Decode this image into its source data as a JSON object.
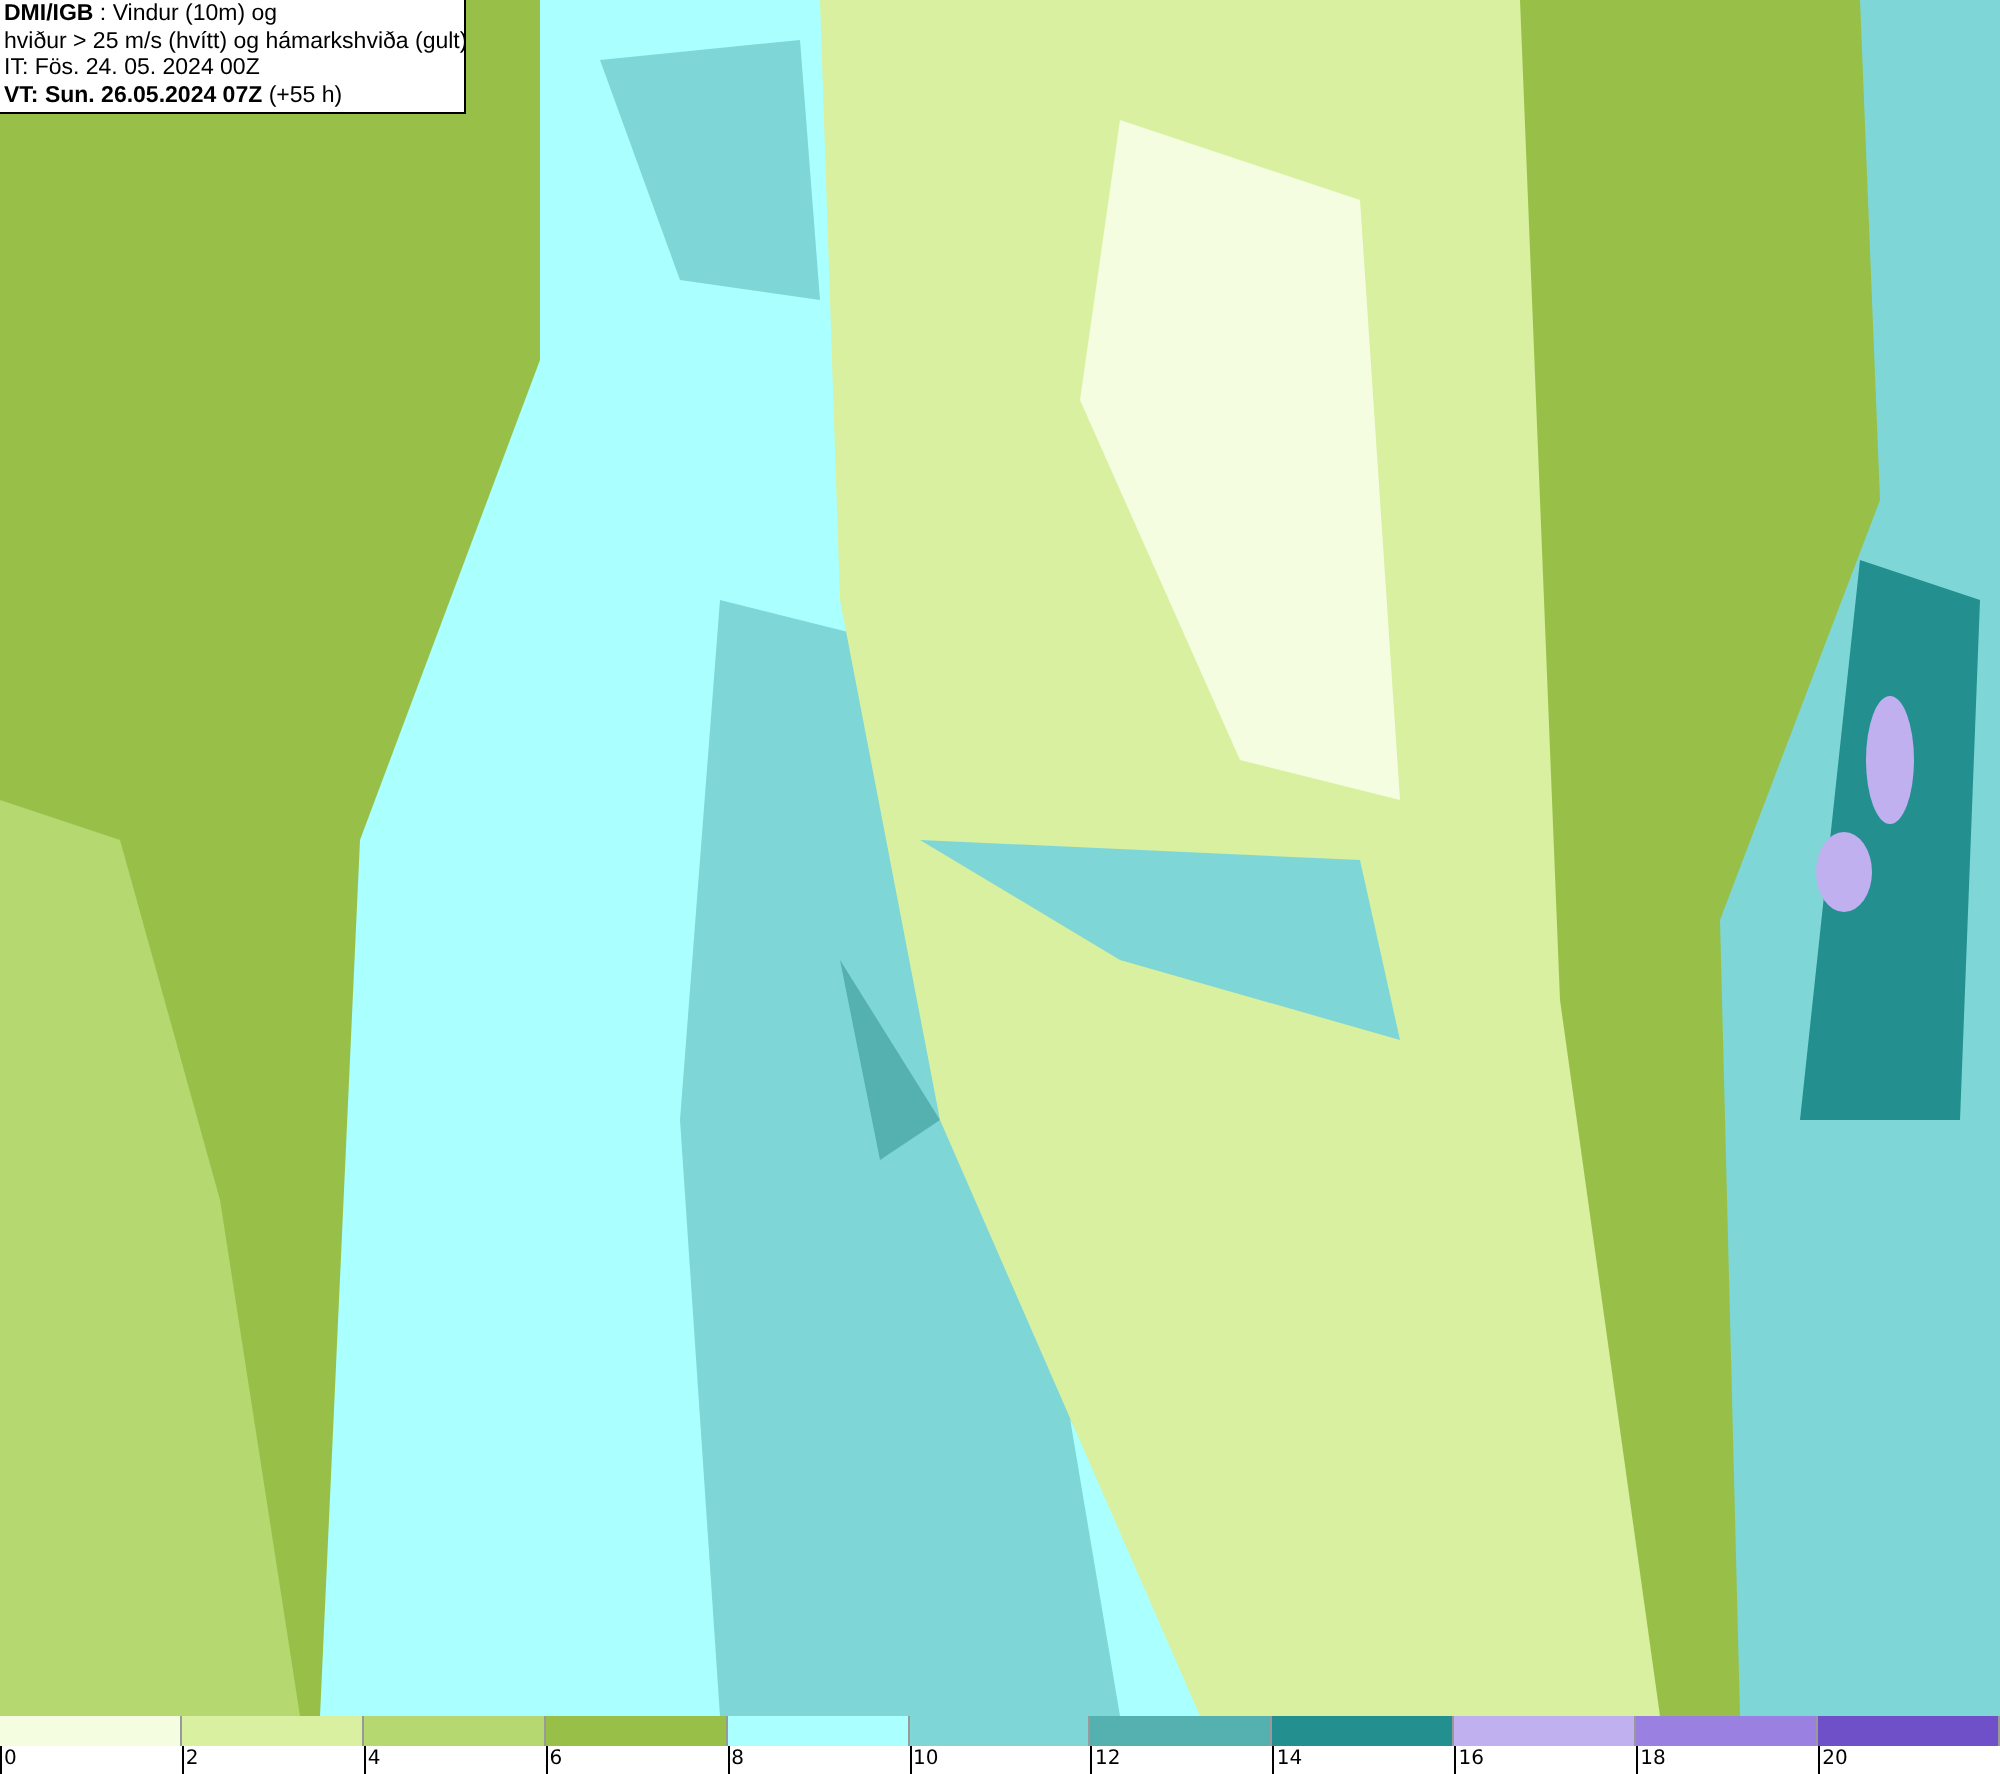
{
  "header": {
    "lines": [
      "**DMI/IGB** : Vindur (10m) og",
      "hviður > 25 m/s (hvítt) og hámarkshviða (gult)",
      "IT: Fös. 24. 05. 2024 00Z",
      "**VT: Sun. 26.05.2024 07Z** (+55 h)"
    ]
  },
  "legend": {
    "bins": [
      {
        "color": "#f5fde0"
      },
      {
        "color": "#d8f0a0"
      },
      {
        "color": "#b5d870"
      },
      {
        "color": "#98c048"
      },
      {
        "color": "#aaffff"
      },
      {
        "color": "#7fd6d6"
      },
      {
        "color": "#55b0b0"
      },
      {
        "color": "#238f8f"
      },
      {
        "color": "#c0b0f0"
      },
      {
        "color": "#9a80e0"
      },
      {
        "color": "#7050c8"
      }
    ],
    "ticks": [
      "0",
      "2",
      "4",
      "6",
      "8",
      "10",
      "12",
      "14",
      "16",
      "18",
      "20"
    ]
  }
}
